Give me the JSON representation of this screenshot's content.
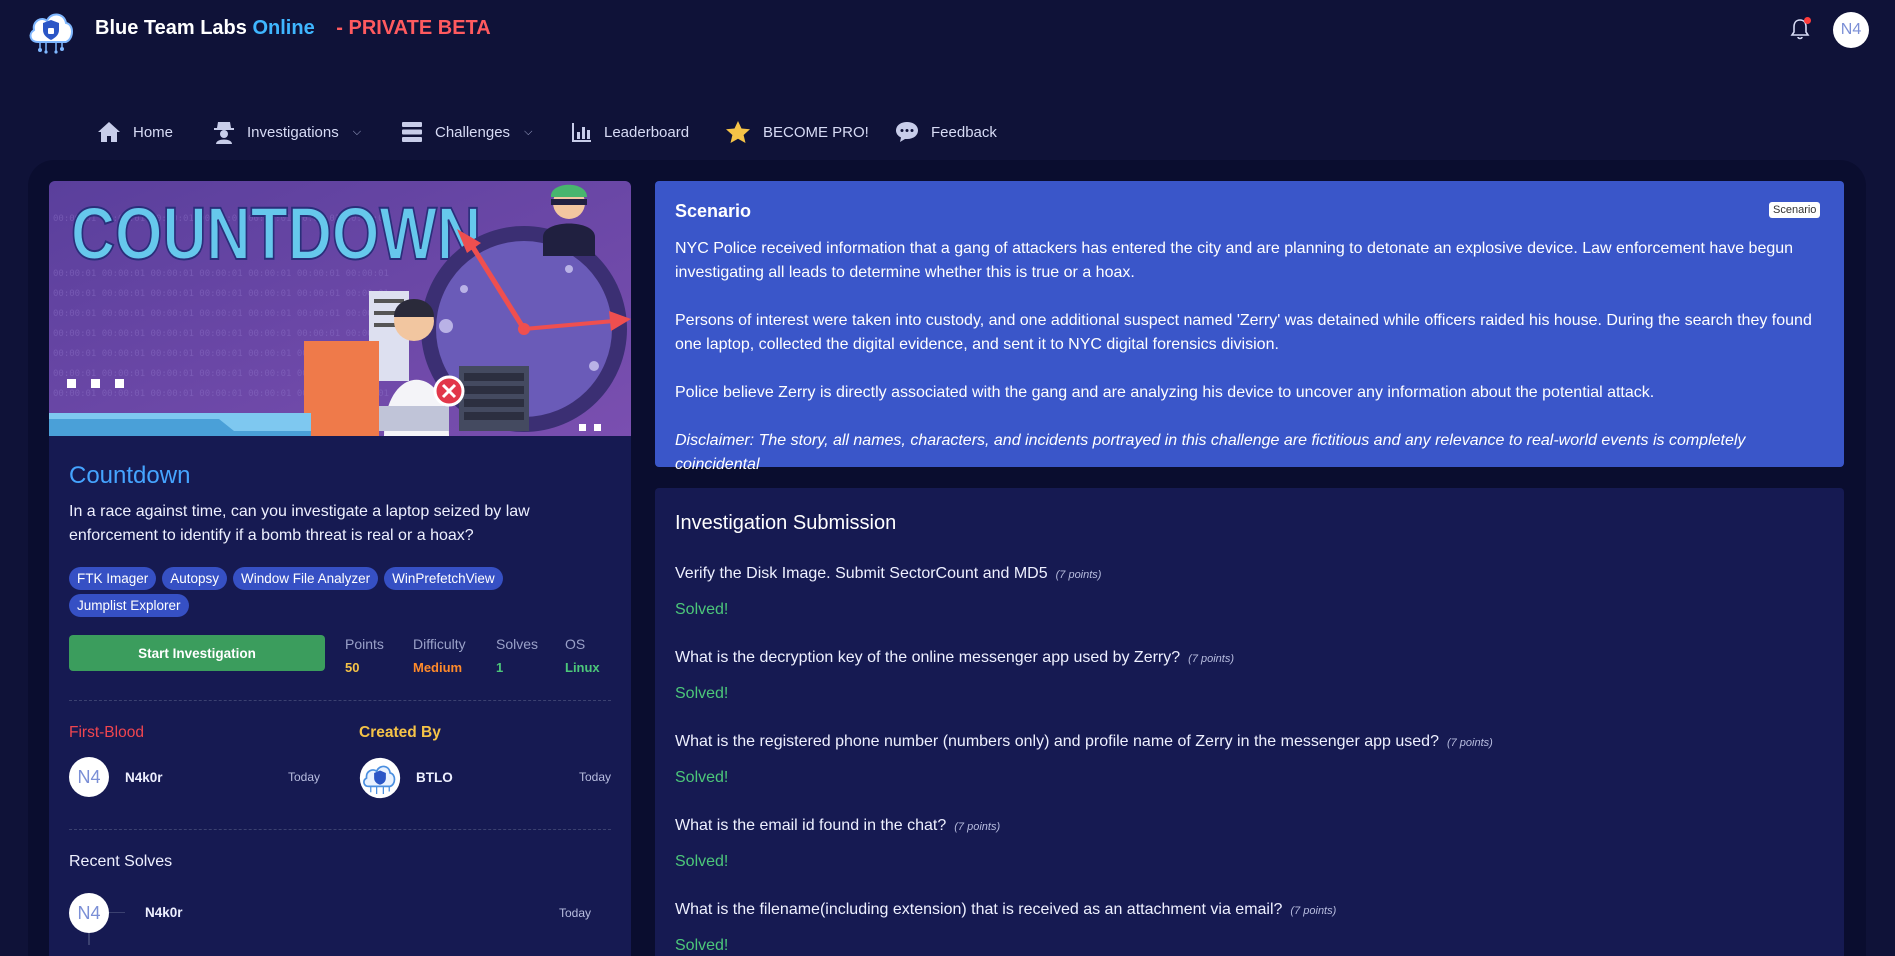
{
  "header": {
    "brand_main": "Blue Team Labs",
    "brand_online": "Online",
    "brand_beta": "- PRIVATE BETA",
    "user_initials": "N4"
  },
  "nav": {
    "items": [
      {
        "label": "Home",
        "icon": "home-icon"
      },
      {
        "label": "Investigations",
        "icon": "detective-icon",
        "dropdown": true
      },
      {
        "label": "Challenges",
        "icon": "server-icon",
        "dropdown": true
      },
      {
        "label": "Leaderboard",
        "icon": "bar-chart-icon"
      },
      {
        "label": "BECOME PRO!",
        "icon": "star-icon"
      },
      {
        "label": "Feedback",
        "icon": "chat-icon"
      }
    ],
    "chevron": "⌵"
  },
  "challenge": {
    "banner_text": "COUNTDOWN",
    "title": "Countdown",
    "description": "In a race against time, can you investigate a laptop seized by law enforcement to identify if a bomb threat is real or a hoax?",
    "tags": [
      "FTK Imager",
      "Autopsy",
      "Window File Analyzer",
      "WinPrefetchView",
      "Jumplist Explorer"
    ],
    "start_label": "Start Investigation",
    "stats": {
      "points_label": "Points",
      "points_value": "50",
      "points_color": "#f5c347",
      "difficulty_label": "Difficulty",
      "difficulty_value": "Medium",
      "difficulty_color": "#ff8a2a",
      "solves_label": "Solves",
      "solves_value": "1",
      "solves_color": "#4cc77a",
      "os_label": "OS",
      "os_value": "Linux",
      "os_color": "#4cc77a"
    },
    "first_blood": {
      "heading": "First-Blood",
      "initials": "N4",
      "name": "N4k0r",
      "when": "Today"
    },
    "created_by": {
      "heading": "Created By",
      "name": "BTLO",
      "when": "Today"
    },
    "recent_solves": {
      "heading": "Recent Solves",
      "items": [
        {
          "initials": "N4",
          "name": "N4k0r",
          "when": "Today"
        }
      ]
    }
  },
  "scenario": {
    "title": "Scenario",
    "badge": "Scenario",
    "p1": "NYC Police received information that a gang of attackers has entered the city and are planning to detonate an explosive device. Law enforcement have begun investigating all leads to determine whether this is true or a hoax.",
    "p2": "Persons of interest were taken into custody, and one additional suspect named 'Zerry' was detained while officers raided his house. During the search they found one laptop, collected the digital evidence, and sent it to NYC digital forensics division.",
    "p3": "Police believe Zerry is directly associated with the gang and are analyzing his device to uncover any information about the potential attack.",
    "disclaimer": "Disclaimer: The story, all names, characters, and incidents portrayed in this challenge are fictitious and any relevance to real-world events is completely coincidental"
  },
  "submission": {
    "title": "Investigation Submission",
    "questions": [
      {
        "text": "Verify the Disk Image. Submit SectorCount and MD5",
        "points": "(7 points)",
        "status": "Solved!"
      },
      {
        "text": "What is the decryption key of the online messenger app used by Zerry?",
        "points": "(7 points)",
        "status": "Solved!"
      },
      {
        "text": "What is the registered phone number (numbers only) and profile name of Zerry in the messenger app used?",
        "points": "(7 points)",
        "status": "Solved!"
      },
      {
        "text": "What is the email id found in the chat?",
        "points": "(7 points)",
        "status": "Solved!"
      },
      {
        "text": "What is the filename(including extension) that is received as an attachment via email?",
        "points": "(7 points)",
        "status": "Solved!"
      }
    ]
  },
  "colors": {
    "background": "#0f1238",
    "card": "#161a52",
    "scenario": "#3a56c9",
    "accent_blue": "#45a4ff",
    "success": "#4cc77a",
    "danger": "#f0454f",
    "warning": "#f5c347"
  }
}
